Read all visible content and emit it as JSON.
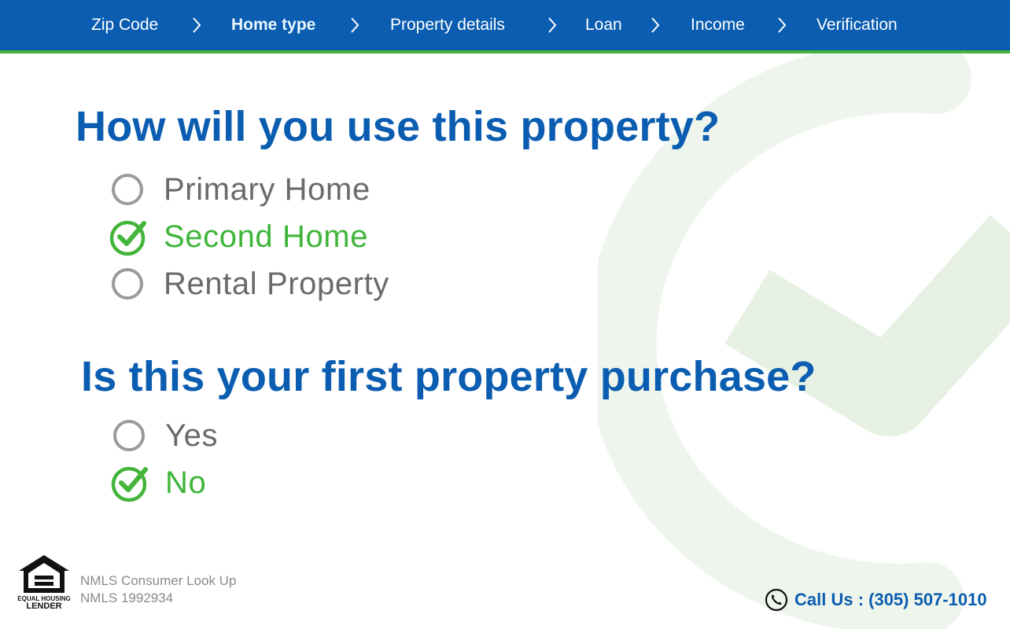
{
  "nav": {
    "steps": [
      {
        "label": "Zip Code"
      },
      {
        "label": "Home type"
      },
      {
        "label": "Property details"
      },
      {
        "label": "Loan"
      },
      {
        "label": "Income"
      },
      {
        "label": "Verification"
      }
    ],
    "active_step": "Home type"
  },
  "q1": {
    "title": "How will you use this property?",
    "options": [
      {
        "label": "Primary Home",
        "selected": false
      },
      {
        "label": "Second Home",
        "selected": true
      },
      {
        "label": "Rental Property",
        "selected": false
      }
    ]
  },
  "q2": {
    "title": "Is this your first property purchase?",
    "options": [
      {
        "label": "Yes",
        "selected": false
      },
      {
        "label": "No",
        "selected": true
      }
    ]
  },
  "footer": {
    "logo_line1": "EQUAL HOUSING",
    "logo_line2": "LENDER",
    "nmls_link": "NMLS Consumer Look Up",
    "nmls_id": "NMLS 1992934",
    "call": "Call Us : (305) 507-1010"
  },
  "colors": {
    "brand_blue": "#0a5db0",
    "accent_green": "#43b53a",
    "text_gray": "#6a6a6a"
  }
}
